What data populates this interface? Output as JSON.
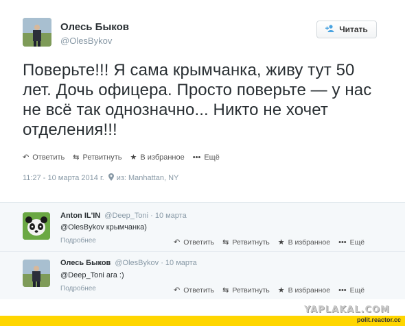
{
  "tweet": {
    "author_name": "Олесь Быков",
    "author_handle": "@OlesBykov",
    "follow_label": "Читать",
    "text": "Поверьте!!! Я сама крымчанка, живу тут 50 лет. Дочь офицера. Просто поверьте — у нас не всё так однозначно... Никто не хочет отделения!!!",
    "actions": {
      "reply": "Ответить",
      "retweet": "Ретвитнуть",
      "favorite": "В избранное",
      "more": "Ещё"
    },
    "timestamp": "11:27 - 10 марта 2014 г.",
    "location": "из: Manhattan, NY"
  },
  "replies": [
    {
      "name": "Anton IL'IN",
      "handle": "@Deep_Toni",
      "date": "· 10 марта",
      "mention": "@OlesBykov",
      "text": " крымчанка)",
      "more": "Подробнее"
    },
    {
      "name": "Олесь Быков",
      "handle": "@OlesBykov",
      "date": "· 10 марта",
      "mention": "@Deep_Toni",
      "text": " ага :)",
      "more": "Подробнее"
    }
  ],
  "reply_actions": {
    "reply": "Ответить",
    "retweet": "Ретвитнуть",
    "favorite": "В избранное",
    "more": "Ещё"
  },
  "watermark": {
    "yaplakal": "YAPLAKAL.COM",
    "reactor": "polit.reactor.cc"
  },
  "icons": {
    "follow": "add-user-icon",
    "reply": "reply-arrow-icon",
    "retweet": "retweet-icon",
    "favorite": "star-icon",
    "more": "ellipsis-icon",
    "location": "pin-icon"
  }
}
